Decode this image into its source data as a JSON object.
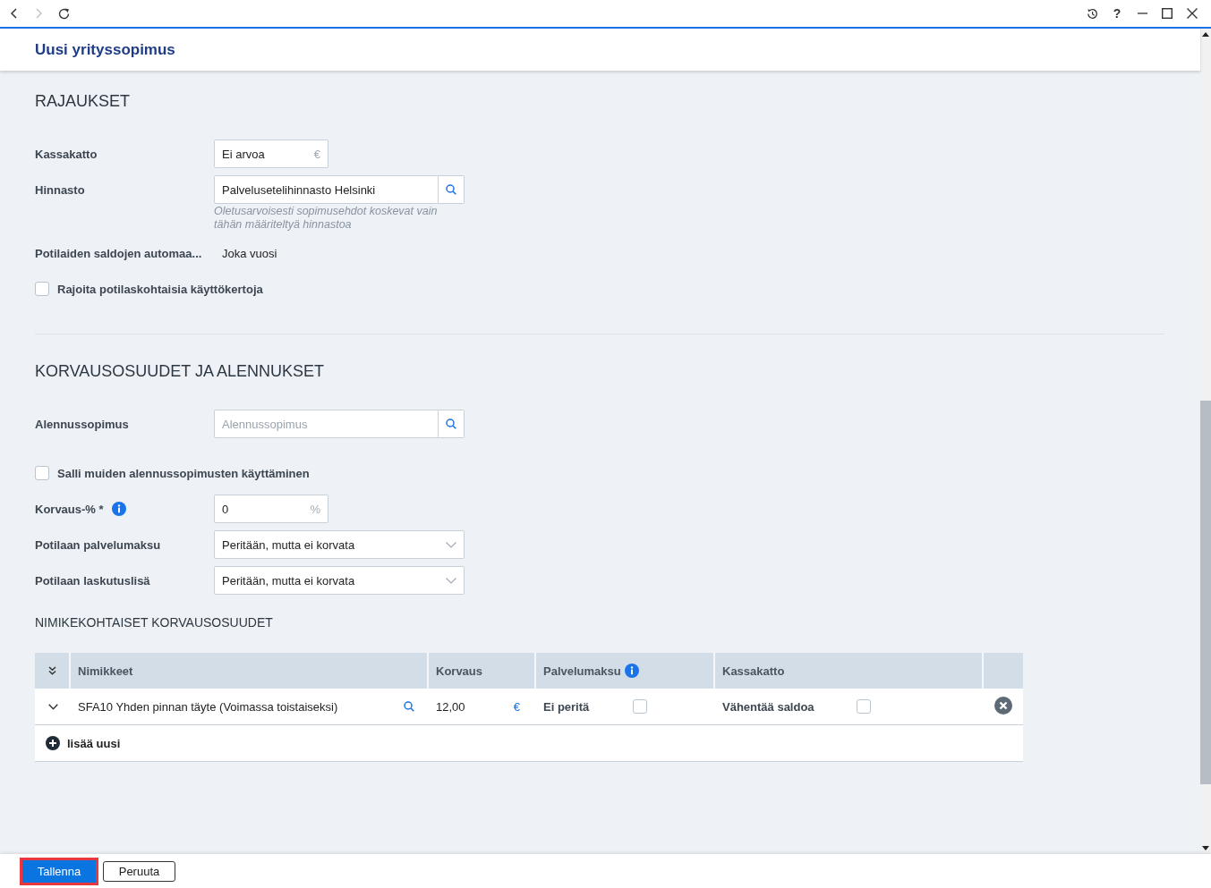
{
  "toolbar": {
    "forward_disabled": true,
    "help_label": "?"
  },
  "header": {
    "title": "Uusi yrityssopimus"
  },
  "sections": [
    {
      "heading": "RAJAUKSET",
      "fields": [
        {
          "kind": "amount",
          "label": "Kassakatto",
          "value": "Ei arvoa",
          "suffix": "€"
        },
        {
          "kind": "lookup",
          "label": "Hinnasto",
          "value": "Palvelusetelihinnasto Helsinki",
          "hint": "Oletusarvoisesti sopimusehdot koskevat vain tähän määriteltyä hinnastoa"
        },
        {
          "kind": "text",
          "label": "Potilaiden saldojen automaa...",
          "value": "Joka vuosi"
        },
        {
          "kind": "checkbox",
          "label": "Rajoita potilaskohtaisia käyttökertoja",
          "checked": false
        }
      ]
    },
    {
      "heading": "KORVAUSOSUUDET JA ALENNUKSET",
      "fields": [
        {
          "kind": "lookup",
          "label": "Alennussopimus",
          "placeholder": "Alennussopimus"
        },
        {
          "kind": "checkbox",
          "label": "Salli muiden alennussopimusten käyttäminen",
          "checked": false
        },
        {
          "kind": "amount",
          "label": "Korvaus-% *",
          "info": true,
          "value": "0",
          "suffix": "%"
        },
        {
          "kind": "select",
          "label": "Potilaan palvelumaksu",
          "value": "Peritään, mutta ei korvata"
        },
        {
          "kind": "select",
          "label": "Potilaan laskutuslisä",
          "value": "Peritään, mutta ei korvata"
        }
      ],
      "table": {
        "heading": "NIMIKEKOHTAISET KORVAUSOSUUDET",
        "columns": [
          {
            "label": "Nimikkeet"
          },
          {
            "label": "Korvaus"
          },
          {
            "label": "Palvelumaksu",
            "info": true
          },
          {
            "label": "Kassakatto"
          }
        ],
        "rows": [
          {
            "item": "SFA10 Yhden pinnan täyte (Voimassa toistaiseksi)",
            "korvaus": "12,00",
            "korvaus_unit": "€",
            "palvelumaksu": "Ei peritä",
            "palvelumaksu_checked": false,
            "kassakatto": "Vähentää saldoa",
            "kassakatto_checked": false
          }
        ],
        "add_label": "lisää uusi"
      }
    }
  ],
  "buttons": [
    {
      "kind": "primary",
      "label": "Tallenna",
      "highlighted": true
    },
    {
      "kind": "secondary",
      "label": "Peruuta",
      "highlighted": false
    }
  ]
}
